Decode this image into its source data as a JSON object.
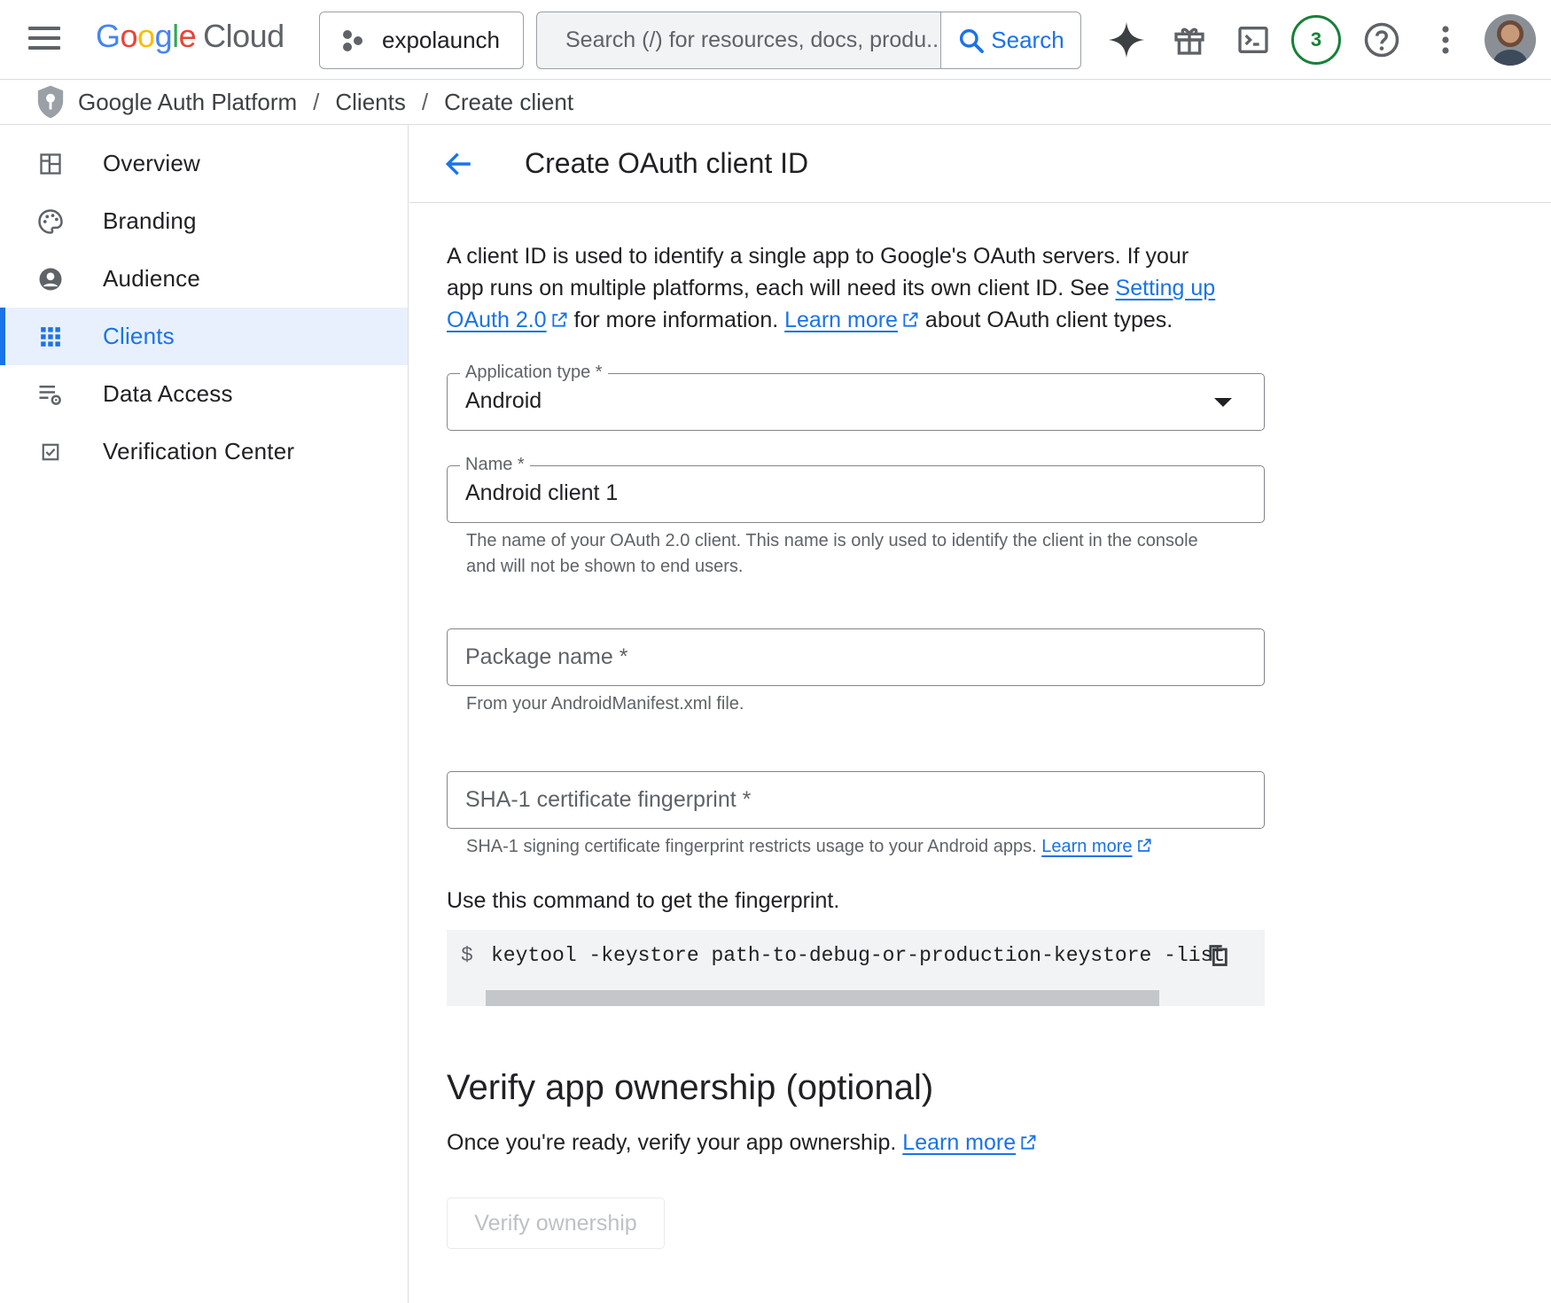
{
  "topbar": {
    "logo_google": [
      "G",
      "o",
      "o",
      "g",
      "l",
      "e"
    ],
    "logo_cloud": "Cloud",
    "project": "expolaunch",
    "search_placeholder": "Search (/) for resources, docs, produ...",
    "search_button": "Search",
    "notification_count": "3"
  },
  "breadcrumb": {
    "items": [
      "Google Auth Platform",
      "Clients",
      "Create client"
    ],
    "separator": "/"
  },
  "sidebar": {
    "items": [
      {
        "label": "Overview",
        "icon": "dashboard-icon"
      },
      {
        "label": "Branding",
        "icon": "palette-icon"
      },
      {
        "label": "Audience",
        "icon": "account-circle-icon"
      },
      {
        "label": "Clients",
        "icon": "apps-grid-icon",
        "active": true
      },
      {
        "label": "Data Access",
        "icon": "list-settings-icon"
      },
      {
        "label": "Verification Center",
        "icon": "checkbox-icon"
      }
    ]
  },
  "page": {
    "title": "Create OAuth client ID",
    "intro_part1": "A client ID is used to identify a single app to Google's OAuth servers. If your app runs on multiple platforms, each will need its own client ID. See ",
    "intro_link1": "Setting up OAuth 2.0",
    "intro_part2": " for more information. ",
    "intro_link2": "Learn more",
    "intro_part3": " about OAuth client types."
  },
  "form": {
    "app_type_label": "Application type *",
    "app_type_value": "Android",
    "name_label": "Name *",
    "name_value": "Android client 1",
    "name_hint": "The name of your OAuth 2.0 client. This name is only used to identify the client in the console and will not be shown to end users.",
    "package_placeholder": "Package name *",
    "package_hint": "From your AndroidManifest.xml file.",
    "sha1_placeholder": "SHA-1 certificate fingerprint *",
    "sha1_hint": "SHA-1 signing certificate fingerprint restricts usage to your Android apps. ",
    "sha1_hint_link": "Learn more",
    "command_intro": "Use this command to get the fingerprint.",
    "command_prompt": "$",
    "command": "keytool -keystore path-to-debug-or-production-keystore -list"
  },
  "verify": {
    "title": "Verify app ownership (optional)",
    "text": "Once you're ready, verify your app ownership. ",
    "link": "Learn more",
    "button": "Verify ownership"
  },
  "colors": {
    "accent": "#1a73e8",
    "active_bg": "#e8f0fe",
    "badge_green": "#188038"
  }
}
